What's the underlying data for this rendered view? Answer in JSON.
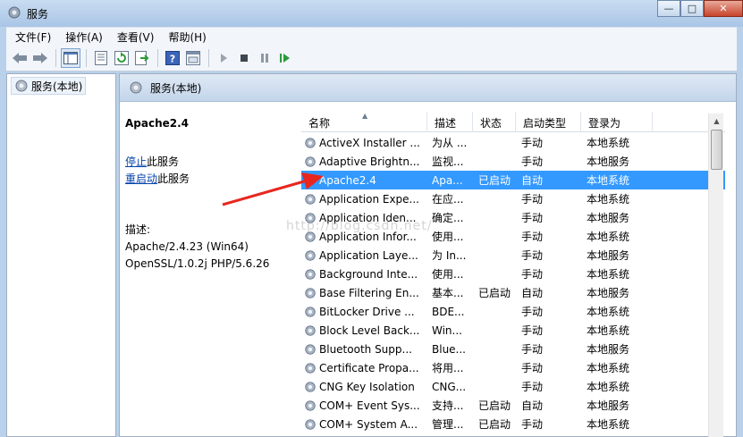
{
  "window": {
    "title": "服务"
  },
  "menu": [
    "文件(F)",
    "操作(A)",
    "查看(V)",
    "帮助(H)"
  ],
  "tree": {
    "root_label": "服务(本地)"
  },
  "main": {
    "header_label": "服务(本地)",
    "selected_name": "Apache2.4",
    "stop_link": "停止",
    "stop_suffix": "此服务",
    "restart_link": "重启动",
    "restart_suffix": "此服务",
    "desc_label": "描述:",
    "desc_line1": "Apache/2.4.23 (Win64)",
    "desc_line2": "OpenSSL/1.0.2j PHP/5.6.26"
  },
  "columns": {
    "name": "名称",
    "desc": "描述",
    "status": "状态",
    "startup": "启动类型",
    "logon": "登录为"
  },
  "services": [
    {
      "name": "ActiveX Installer ...",
      "desc": "为从 ...",
      "status": "",
      "startup": "手动",
      "logon": "本地系统"
    },
    {
      "name": "Adaptive Brightn...",
      "desc": "监视...",
      "status": "",
      "startup": "手动",
      "logon": "本地服务"
    },
    {
      "name": "Apache2.4",
      "desc": "Apa...",
      "status": "已启动",
      "startup": "自动",
      "logon": "本地系统",
      "selected": true
    },
    {
      "name": "Application Expe...",
      "desc": "在应...",
      "status": "",
      "startup": "手动",
      "logon": "本地系统"
    },
    {
      "name": "Application Iden...",
      "desc": "确定...",
      "status": "",
      "startup": "手动",
      "logon": "本地服务"
    },
    {
      "name": "Application Infor...",
      "desc": "使用...",
      "status": "",
      "startup": "手动",
      "logon": "本地系统"
    },
    {
      "name": "Application Laye...",
      "desc": "为 In...",
      "status": "",
      "startup": "手动",
      "logon": "本地服务"
    },
    {
      "name": "Background Inte...",
      "desc": "使用...",
      "status": "",
      "startup": "手动",
      "logon": "本地系统"
    },
    {
      "name": "Base Filtering En...",
      "desc": "基本...",
      "status": "已启动",
      "startup": "自动",
      "logon": "本地服务"
    },
    {
      "name": "BitLocker Drive ...",
      "desc": "BDE...",
      "status": "",
      "startup": "手动",
      "logon": "本地系统"
    },
    {
      "name": "Block Level Back...",
      "desc": "Win...",
      "status": "",
      "startup": "手动",
      "logon": "本地系统"
    },
    {
      "name": "Bluetooth Supp...",
      "desc": "Blue...",
      "status": "",
      "startup": "手动",
      "logon": "本地服务"
    },
    {
      "name": "Certificate Propa...",
      "desc": "将用...",
      "status": "",
      "startup": "手动",
      "logon": "本地系统"
    },
    {
      "name": "CNG Key Isolation",
      "desc": "CNG...",
      "status": "",
      "startup": "手动",
      "logon": "本地系统"
    },
    {
      "name": "COM+ Event Sys...",
      "desc": "支持...",
      "status": "已启动",
      "startup": "自动",
      "logon": "本地服务"
    },
    {
      "name": "COM+ System A...",
      "desc": "管理...",
      "status": "已启动",
      "startup": "手动",
      "logon": "本地系统"
    }
  ],
  "watermark": "http://blog.csdn.net/",
  "colors": {
    "selection": "#3399ff",
    "arrow": "#e8261f",
    "link": "#0645ad"
  },
  "icons": [
    "back-icon",
    "forward-icon",
    "console-tree-icon",
    "properties-icon",
    "refresh-icon",
    "export-icon",
    "help-icon",
    "view-icon",
    "play-icon",
    "stop-icon",
    "pause-icon",
    "resume-icon",
    "gear-icon"
  ]
}
